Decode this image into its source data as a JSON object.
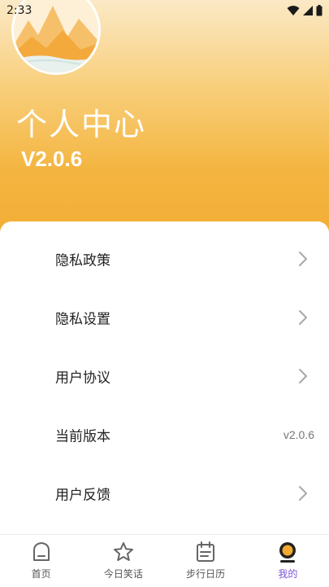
{
  "status_bar": {
    "time": "2:33",
    "icons": [
      "wifi-icon",
      "cell-signal-icon",
      "battery-icon"
    ]
  },
  "profile": {
    "title": "个人中心",
    "version": "V2.0.6"
  },
  "menu": {
    "items": [
      {
        "label": "隐私政策",
        "value": "",
        "has_chevron": true
      },
      {
        "label": "隐私设置",
        "value": "",
        "has_chevron": true
      },
      {
        "label": "用户协议",
        "value": "",
        "has_chevron": true
      },
      {
        "label": "当前版本",
        "value": "v2.0.6",
        "has_chevron": false
      },
      {
        "label": "用户反馈",
        "value": "",
        "has_chevron": true
      }
    ]
  },
  "bottom_nav": {
    "items": [
      {
        "label": "首页",
        "icon": "home-icon",
        "active": false
      },
      {
        "label": "今日笑话",
        "icon": "star-icon",
        "active": false
      },
      {
        "label": "步行日历",
        "icon": "calendar-icon",
        "active": false
      },
      {
        "label": "我的",
        "icon": "profile-icon",
        "active": true
      }
    ]
  },
  "colors": {
    "hero_top": "#fbe9c6",
    "hero_bottom": "#f2ad35",
    "active_nav": "#7b53d6",
    "active_icon_ring": "#f2a92f"
  }
}
